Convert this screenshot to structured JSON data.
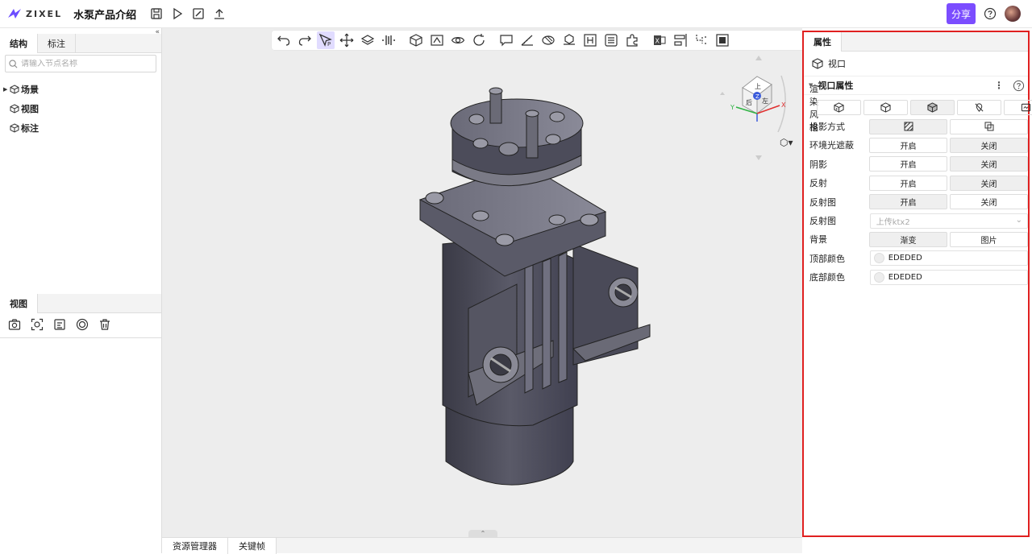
{
  "app": {
    "logo_text": "ZIXEL",
    "title": "水泵产品介绍",
    "share_label": "分享"
  },
  "left": {
    "tabs": [
      {
        "label": "结构"
      },
      {
        "label": "标注"
      }
    ],
    "search_placeholder": "请输入节点名称",
    "tree": [
      {
        "label": "场景"
      },
      {
        "label": "视图"
      },
      {
        "label": "标注"
      }
    ],
    "view_tab": "视图"
  },
  "bottom": {
    "tabs": [
      {
        "label": "资源管理器"
      },
      {
        "label": "关键帧"
      }
    ]
  },
  "right": {
    "tab": "属性",
    "object_label": "视口",
    "section_title": "视口属性",
    "rows": {
      "render_style": {
        "label": "渲染风格"
      },
      "projection": {
        "label": "投影方式"
      },
      "ao": {
        "label": "环境光遮蔽",
        "on": "开启",
        "off": "关闭"
      },
      "shadow": {
        "label": "阴影",
        "on": "开启",
        "off": "关闭"
      },
      "reflect": {
        "label": "反射",
        "on": "开启",
        "off": "关闭"
      },
      "reflect_map": {
        "label": "反射图",
        "on": "开启",
        "off": "关闭"
      },
      "reflect_map_upload": {
        "label": "反射图",
        "placeholder": "上传ktx2"
      },
      "background": {
        "label": "背景",
        "opt1": "渐变",
        "opt2": "图片"
      },
      "top_color": {
        "label": "顶部颜色",
        "value": "EDEDED"
      },
      "bottom_color": {
        "label": "底部颜色",
        "value": "EDEDED"
      }
    }
  },
  "navcube": {
    "face_top": "上",
    "face_front": "后",
    "face_right": "左",
    "axis_x": "X",
    "axis_y": "Y",
    "axis_z": "Z"
  },
  "colors": {
    "accent": "#7b4dff",
    "highlight_border": "#e02020",
    "viewport_bg": "#ededed",
    "swatch": "#ededed"
  }
}
